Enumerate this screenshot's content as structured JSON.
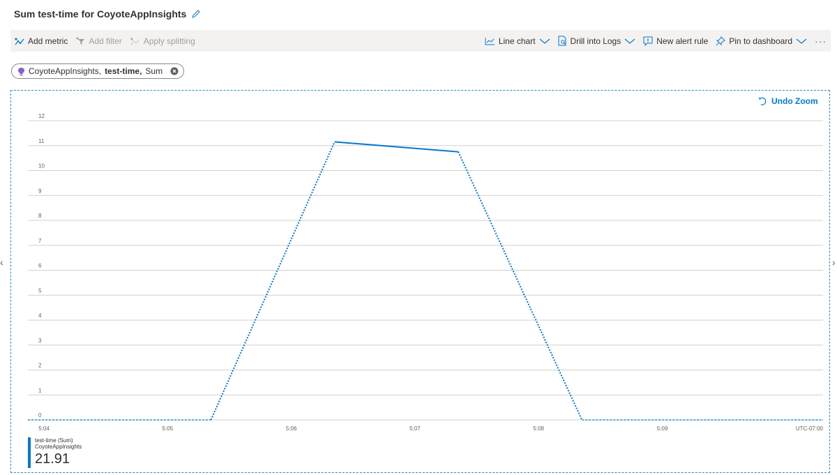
{
  "header": {
    "title": "Sum test-time for CoyoteAppInsights",
    "edit_icon": "pencil-icon"
  },
  "toolbar": {
    "left": [
      {
        "label": "Add metric",
        "icon": "add-metric-icon",
        "enabled": true
      },
      {
        "label": "Add filter",
        "icon": "filter-icon",
        "enabled": false
      },
      {
        "label": "Apply splitting",
        "icon": "splitting-icon",
        "enabled": false
      }
    ],
    "right": [
      {
        "label": "Line chart",
        "icon": "line-chart-icon",
        "dropdown": true
      },
      {
        "label": "Drill into Logs",
        "icon": "logs-icon",
        "dropdown": true
      },
      {
        "label": "New alert rule",
        "icon": "alert-icon",
        "dropdown": false
      },
      {
        "label": "Pin to dashboard",
        "icon": "pin-icon",
        "dropdown": true
      }
    ],
    "more": "···"
  },
  "metric_pill": {
    "resource": "CoyoteAppInsights,",
    "metric": "test-time,",
    "aggregation": "Sum",
    "resource_icon": "app-insights-icon",
    "remove_icon": "remove-icon"
  },
  "undo_zoom": "Undo Zoom",
  "chart_data": {
    "type": "line",
    "x_ticks": [
      "5:04",
      "5:05",
      "5:06",
      "5:07",
      "5:08",
      "5:09"
    ],
    "x_tick_minutes": [
      0,
      1,
      2,
      3,
      4,
      5
    ],
    "x_unit_label": "UTC-07:00",
    "y_ticks": [
      0,
      1,
      2,
      3,
      4,
      5,
      6,
      7,
      8,
      9,
      10,
      11,
      12
    ],
    "ylim": [
      0,
      12
    ],
    "xlim_minutes": [
      -0.13,
      6.3
    ],
    "series": [
      {
        "name": "test-time (Sum)",
        "color": "#0078d4",
        "points": [
          {
            "x": -0.13,
            "y": 0,
            "dashed": true
          },
          {
            "x": 1.35,
            "y": 0,
            "dashed": true
          },
          {
            "x": 2.35,
            "y": 11.15,
            "dashed": true
          },
          {
            "x": 3.35,
            "y": 10.75,
            "dashed": false
          },
          {
            "x": 4.35,
            "y": 0,
            "dashed": true
          },
          {
            "x": 6.3,
            "y": 0,
            "dashed": true
          }
        ]
      }
    ]
  },
  "legend": {
    "series_label": "test-time (Sum)",
    "resource": "CoyoteAppInsights",
    "value": "21.91"
  }
}
